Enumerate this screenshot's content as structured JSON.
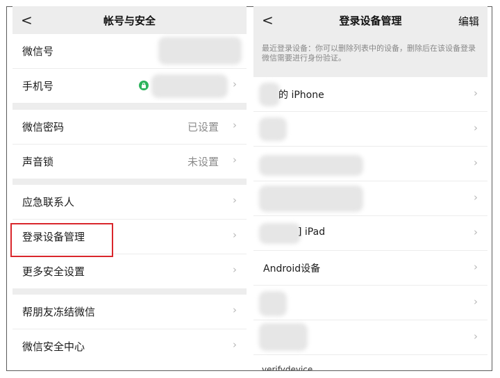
{
  "account_security": {
    "back_icon": "chevron-left-icon",
    "title": "帐号与安全",
    "rows": [
      {
        "label": "微信号",
        "value": ""
      },
      {
        "label": "手机号",
        "value": ""
      },
      {
        "label": "微信密码",
        "value": "已设置"
      },
      {
        "label": "声音锁",
        "value": "未设置"
      },
      {
        "label": "应急联系人",
        "value": ""
      },
      {
        "label": "登录设备管理",
        "value": ""
      },
      {
        "label": "更多安全设置",
        "value": ""
      },
      {
        "label": "帮朋友冻结微信",
        "value": ""
      },
      {
        "label": "微信安全中心",
        "value": ""
      }
    ],
    "chevron": "›"
  },
  "device_management": {
    "back_icon": "chevron-left-icon",
    "title": "登录设备管理",
    "edit_label": "编辑",
    "description": "最近登录设备：你可以删除列表中的设备，删除后在该设备登录微信需要进行身份验证。",
    "devices": [
      {
        "label": "的 iPhone"
      },
      {
        "label": ""
      },
      {
        "label": ""
      },
      {
        "label": ""
      },
      {
        "label": "] iPad"
      },
      {
        "label": "Android设备"
      },
      {
        "label": ""
      },
      {
        "label": ""
      }
    ],
    "partial_last": "verifydevice",
    "chevron": "›"
  },
  "colors": {
    "accent_lock": "#2db35c",
    "highlight": "#d9262b",
    "background_gray": "#ededed"
  }
}
